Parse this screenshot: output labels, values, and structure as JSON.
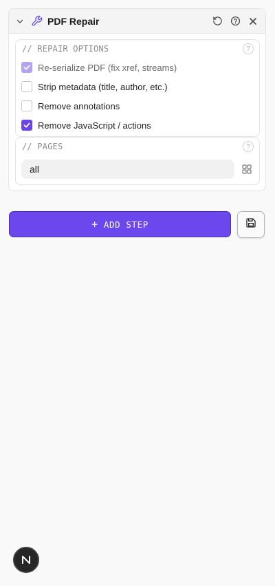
{
  "panel": {
    "title": "PDF Repair",
    "icons": {
      "collapse": "chevron-down-icon",
      "tool": "wrench-icon",
      "reset": "reset-icon",
      "help": "help-icon",
      "close": "close-icon"
    }
  },
  "repair_options": {
    "title": "// REPAIR OPTIONS",
    "help": "?",
    "items": [
      {
        "label": "Re-serialize PDF (fix xref, streams)",
        "checked": true,
        "disabled": true
      },
      {
        "label": "Strip metadata (title, author, etc.)",
        "checked": false,
        "disabled": false
      },
      {
        "label": "Remove annotations",
        "checked": false,
        "disabled": false
      },
      {
        "label": "Remove JavaScript / actions",
        "checked": true,
        "disabled": false
      }
    ]
  },
  "pages": {
    "title": "// PAGES",
    "help": "?",
    "value": "all",
    "picker_icon": "grid-icon"
  },
  "actions": {
    "add_step_label": "ADD STEP",
    "plus": "+",
    "save_icon": "save-icon"
  },
  "badge": {
    "letter": "N"
  },
  "colors": {
    "accent": "#6b47ee",
    "checkbox_checked": "#6a45e6",
    "checkbox_disabled": "#b3a3f0"
  }
}
